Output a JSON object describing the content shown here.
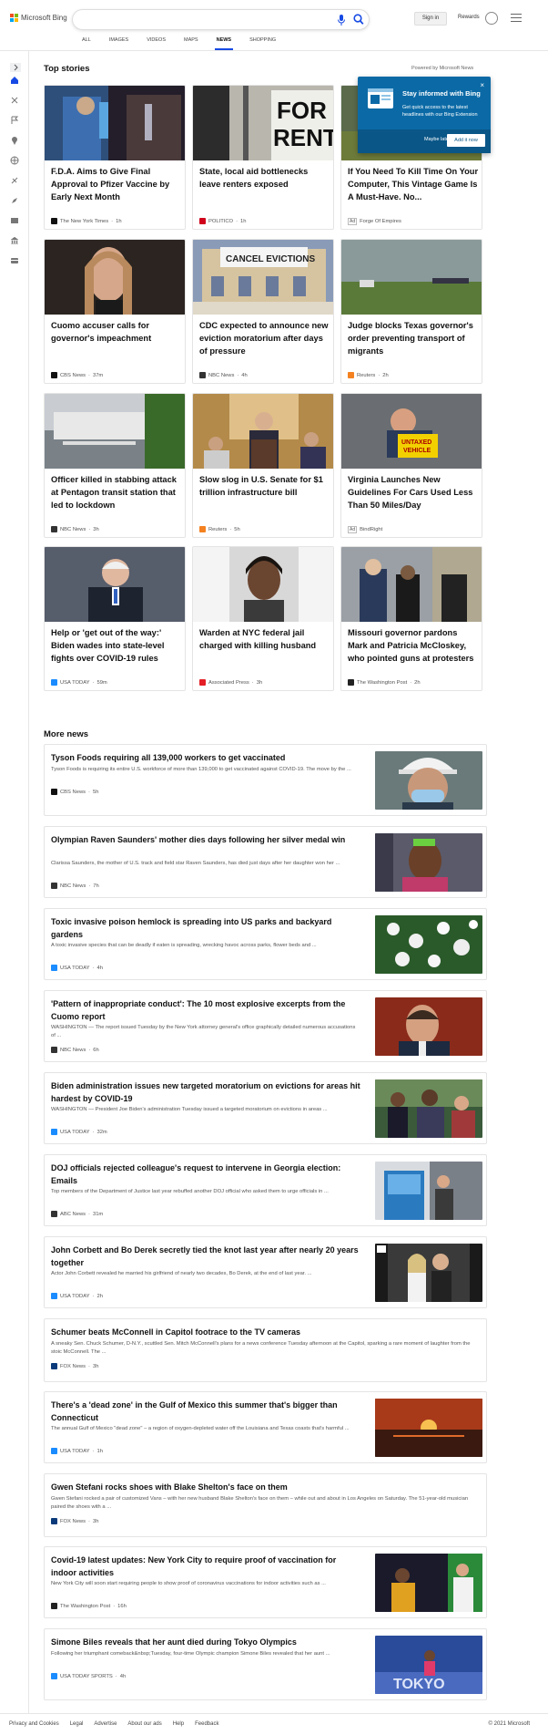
{
  "header": {
    "brand": "Microsoft Bing",
    "search": {
      "value": "",
      "placeholder": ""
    },
    "signin": "Sign in",
    "rewards": "Rewards",
    "nav": [
      {
        "label": "ALL",
        "selected": false
      },
      {
        "label": "IMAGES",
        "selected": false
      },
      {
        "label": "VIDEOS",
        "selected": false
      },
      {
        "label": "MAPS",
        "selected": false
      },
      {
        "label": "NEWS",
        "selected": true
      },
      {
        "label": "SHOPPING",
        "selected": false
      }
    ]
  },
  "top_stories": {
    "heading": "Top stories",
    "powered_by": "Powered by Microsoft News",
    "cards": [
      {
        "title": "F.D.A. Aims to Give Final Approval to Pfizer Vaccine by Early Next Month",
        "source": "The New York Times",
        "age": "1h",
        "ad": "",
        "logo_color": "#111111",
        "image": "lab-scientist-vaccine"
      },
      {
        "title": "State, local aid bottlenecks leave renters exposed",
        "source": "POLITICO",
        "age": "1h",
        "ad": "",
        "logo_color": "#d0021b",
        "image": "for-rent-sign"
      },
      {
        "title": "If You Need To Kill Time On Your Computer, This Vintage Game Is A Must-Have. No...",
        "source": "Forge Of Empires",
        "age": "",
        "ad": "Ad",
        "logo_color": "",
        "image": "game-ad"
      },
      {
        "title": "Cuomo accuser calls for governor's impeachment",
        "source": "CBS News",
        "age": "37m",
        "ad": "",
        "logo_color": "#111111",
        "image": "woman-portrait"
      },
      {
        "title": "CDC expected to announce new eviction moratorium after days of pressure",
        "source": "NBC News",
        "age": "4h",
        "ad": "",
        "logo_color": "#333333",
        "image": "cancel-evictions-building"
      },
      {
        "title": "Judge blocks Texas governor's order preventing transport of migrants",
        "source": "Reuters",
        "age": "2h",
        "ad": "",
        "logo_color": "#f48120",
        "image": "border-landscape"
      },
      {
        "title": "Officer killed in stabbing attack at Pentagon transit station that led to lockdown",
        "source": "NBC News",
        "age": "3h",
        "ad": "",
        "logo_color": "#333333",
        "image": "pentagon-station"
      },
      {
        "title": "Slow slog in U.S. Senate for $1 trillion infrastructure bill",
        "source": "Reuters",
        "age": "5h",
        "ad": "",
        "logo_color": "#f48120",
        "image": "senate-podium"
      },
      {
        "title": "Virginia Launches New Guidelines For Cars Used Less Than 50 Miles/Day",
        "source": "BindRight",
        "age": "",
        "ad": "Ad",
        "logo_color": "",
        "image": "untaxed-vehicle-sign"
      },
      {
        "title": "Help or 'get out of the way:' Biden wades into state-level fights over COVID-19 rules",
        "source": "USA TODAY",
        "age": "59m",
        "ad": "",
        "logo_color": "#1a8cff",
        "image": "biden-podium"
      },
      {
        "title": "Warden at NYC federal jail charged with killing husband",
        "source": "Associated Press",
        "age": "3h",
        "ad": "",
        "logo_color": "#e41f26",
        "image": "mugshot"
      },
      {
        "title": "Missouri governor pardons Mark and Patricia McCloskey, who pointed guns at protesters",
        "source": "The Washington Post",
        "age": "2h",
        "ad": "",
        "logo_color": "#222222",
        "image": "protesters"
      }
    ]
  },
  "popup": {
    "title": "Stay informed with Bing",
    "desc": "Get quick access to the latest headlines with our Bing Extension",
    "later": "Maybe later",
    "add": "Add it now",
    "close": "×"
  },
  "more_news": {
    "heading": "More news",
    "items": [
      {
        "title": "Tyson Foods requiring all 139,000 workers to get vaccinated",
        "desc": "Tyson Foods is requiring its entire U.S. workforce of more than 139,000 to get vaccinated against COVID-19. The move by the ...",
        "source": "CBS News",
        "age": "5h",
        "logo_color": "#111111",
        "image": "worker-hardhat-mask"
      },
      {
        "title": "Olympian Raven Saunders' mother dies days following her silver medal win",
        "desc": "Clarissa Saunders, the mother of U.S. track and field star Raven Saunders, has died just days after her daughter won her ...",
        "source": "NBC News",
        "age": "7h",
        "logo_color": "#333333",
        "image": "raven-saunders"
      },
      {
        "title": "Toxic invasive poison hemlock is spreading into US parks and backyard gardens",
        "desc": "A toxic invasive species that can be deadly if eaten is spreading, wrecking havoc across parks, flower beds and ...",
        "source": "USA TODAY",
        "age": "4h",
        "logo_color": "#1a8cff",
        "image": "white-flowers"
      },
      {
        "title": "'Pattern of inappropriate conduct': The 10 most explosive excerpts from the Cuomo report",
        "desc": "WASHINGTON — The report issued Tuesday by the New York attorney general's office graphically detailed numerous accusations of ...",
        "source": "NBC News",
        "age": "6h",
        "logo_color": "#333333",
        "image": "cuomo"
      },
      {
        "title": "Biden administration issues new targeted moratorium on evictions for areas hit hardest by COVID-19",
        "desc": "WASHINGTON — President Joe Biden's administration Tuesday issued a targeted moratorium on evictions in areas ...",
        "source": "USA TODAY",
        "age": "32m",
        "logo_color": "#1a8cff",
        "image": "crowd-hugging"
      },
      {
        "title": "DOJ officials rejected colleague's request to intervene in Georgia election: Emails",
        "desc": "Top members of the Department of Justice last year rebuffed another DOJ official who asked them to urge officials in ...",
        "source": "ABC News",
        "age": "31m",
        "logo_color": "#333333",
        "image": "voting-booth"
      },
      {
        "title": "John Corbett and Bo Derek secretly tied the knot last year after nearly 20 years together",
        "desc": "Actor John Corbett revealed he married his girlfriend of nearly two decades, Bo Derek, at the end of last year. ...",
        "source": "USA TODAY",
        "age": "2h",
        "logo_color": "#1a8cff",
        "image": "corbett-derek"
      },
      {
        "title": "Schumer beats McConnell in Capitol footrace to the TV cameras",
        "desc": "A sneaky Sen. Chuck Schumer, D-N.Y., scuttled Sen. Mitch McConnell's plans for a news conference Tuesday afternoon at the Capitol, sparking a rare moment of laughter from the stoic McConnell. The ...",
        "source": "FOX News",
        "age": "3h",
        "logo_color": "#0a3a7a",
        "image": ""
      },
      {
        "title": "There's a 'dead zone' in the Gulf of Mexico this summer that's bigger than Connecticut",
        "desc": "The annual Gulf of Mexico \"dead zone\" – a region of oxygen-depleted water off the Louisiana and Texas coasts that's harmful ...",
        "source": "USA TODAY",
        "age": "1h",
        "logo_color": "#1a8cff",
        "image": "gulf-sunset"
      },
      {
        "title": "Gwen Stefani rocks shoes with Blake Shelton's face on them",
        "desc": "Gwen Stefani rocked a pair of customized Vans – with her new husband Blake Shelton's face on them – while out and about in Los Angeles on Saturday. The 51-year-old musician paired the shoes with a ...",
        "source": "FOX News",
        "age": "3h",
        "logo_color": "#0a3a7a",
        "image": ""
      },
      {
        "title": "Covid-19 latest updates: New York City to require proof of vaccination for indoor activities",
        "desc": "New York City will soon start requiring people to show proof of coronavirus vaccinations for indoor activities such as ...",
        "source": "The Washington Post",
        "age": "16h",
        "logo_color": "#222222",
        "image": "nyc-indoor"
      },
      {
        "title": "Simone Biles reveals that her aunt died during Tokyo Olympics",
        "desc": "Following her triumphant comeback&nbsp;Tuesday, four-time Olympic champion Simone Biles revealed that her aunt ...",
        "source": "USA TODAY SPORTS",
        "age": "4h",
        "logo_color": "#1a8cff",
        "image": "tokyo-olympics"
      }
    ]
  },
  "footer": {
    "links": [
      "Privacy and Cookies",
      "Legal",
      "Advertise",
      "About our ads",
      "Help",
      "Feedback"
    ],
    "copyright": "© 2021 Microsoft"
  },
  "colors": {
    "accent": "#174ae4",
    "popup": "#0b6aa6"
  }
}
